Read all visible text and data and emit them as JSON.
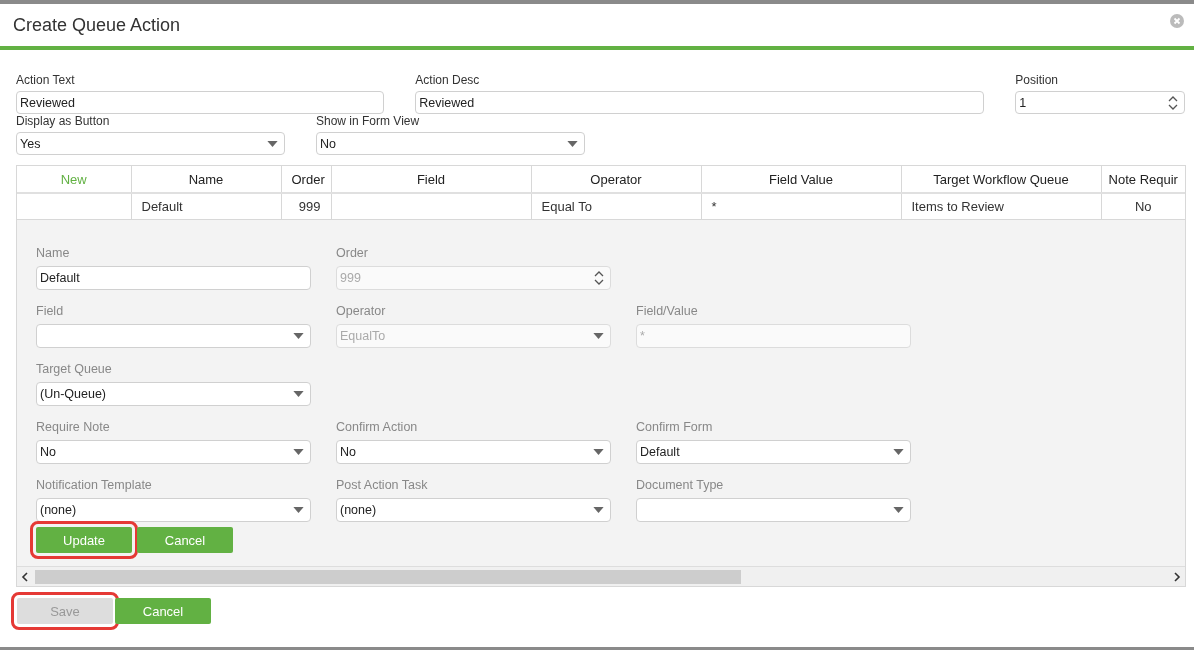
{
  "dialog": {
    "title": "Create Queue Action"
  },
  "top_fields": [
    {
      "label": "Action Text",
      "kind": "text",
      "value": "Reviewed"
    },
    {
      "label": "Action Desc",
      "kind": "text",
      "value": "Reviewed"
    },
    {
      "label": "Position",
      "kind": "number",
      "value": "1"
    }
  ],
  "second_fields": [
    {
      "label": "Display as Button",
      "kind": "select",
      "value": "Yes"
    },
    {
      "label": "Show in Form View",
      "kind": "select",
      "value": "No"
    }
  ],
  "grid": {
    "columns": [
      {
        "label": "New",
        "kind": "command"
      },
      {
        "label": "Name"
      },
      {
        "label": "Order"
      },
      {
        "label": "Field"
      },
      {
        "label": "Operator"
      },
      {
        "label": "Field Value"
      },
      {
        "label": "Target Workflow Queue"
      },
      {
        "label": "Note Requir"
      }
    ],
    "rows": [
      [
        "",
        "Default",
        "999",
        "",
        "Equal To",
        "*",
        "Items to Review",
        "No"
      ]
    ],
    "editor": [
      {
        "fields": [
          {
            "label": "Name",
            "kind": "text",
            "value": "Default",
            "disabled": false
          },
          {
            "label": "Order",
            "kind": "number",
            "value": "999",
            "disabled": true
          }
        ]
      },
      {
        "fields": [
          {
            "label": "Field",
            "kind": "select",
            "disabled": false
          },
          {
            "label": "Operator",
            "kind": "select",
            "value": "EqualTo",
            "disabled": true
          },
          {
            "label": "Field/Value",
            "kind": "text",
            "value": "*",
            "disabled": true
          }
        ]
      },
      {
        "fields": [
          {
            "label": "Target Queue",
            "kind": "select",
            "value": "(Un-Queue)",
            "disabled": false
          }
        ]
      },
      {
        "fields": [
          {
            "label": "Require Note",
            "kind": "select",
            "value": "No",
            "disabled": false
          },
          {
            "label": "Confirm Action",
            "kind": "select",
            "value": "No",
            "disabled": false
          },
          {
            "label": "Confirm Form",
            "kind": "select",
            "value": "Default",
            "disabled": false
          }
        ]
      },
      {
        "fields": [
          {
            "label": "Notification Template",
            "kind": "select",
            "value": "(none)",
            "disabled": false
          },
          {
            "label": "Post Action Task",
            "kind": "select",
            "value": "(none)",
            "disabled": false
          },
          {
            "label": "Document Type",
            "kind": "select",
            "disabled": false
          }
        ]
      }
    ],
    "editor_buttons": [
      {
        "label": "Update",
        "disabled": false,
        "highlighted": true
      },
      {
        "label": "Cancel",
        "disabled": false,
        "highlighted": false
      }
    ]
  },
  "footer_buttons": [
    {
      "label": "Save",
      "disabled": true,
      "highlighted": true
    },
    {
      "label": "Cancel",
      "disabled": false,
      "highlighted": false
    }
  ]
}
